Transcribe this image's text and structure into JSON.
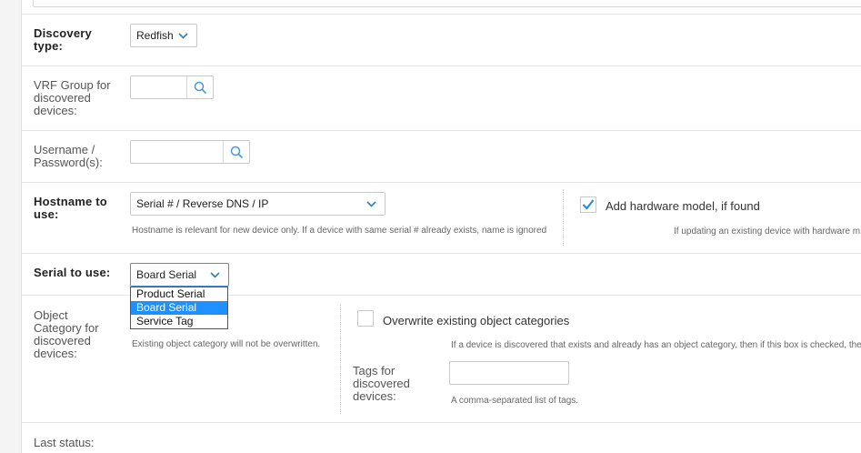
{
  "discovery": {
    "label": "Discovery type:",
    "value": "Redfish"
  },
  "vrf_group": {
    "label": "VRF Group for discovered devices:"
  },
  "credentials": {
    "label": "Username / Password(s):"
  },
  "hostname": {
    "label": "Hostname to use:",
    "value": "Serial # / Reverse DNS / IP",
    "hint": "Hostname is relevant for new device only. If a device with same serial # already exists, name is ignored"
  },
  "hardware_model": {
    "label": "Add hardware model, if found",
    "checked": true,
    "hint": "If updating an existing device with hardware m"
  },
  "serial": {
    "label": "Serial to use:",
    "value": "Board Serial",
    "options": [
      "Product Serial",
      "Board Serial",
      "Service Tag"
    ],
    "highlighted": "Board Serial"
  },
  "object_category": {
    "label": "Object Category for discovered devices:",
    "hint": "Existing object category will not be overwritten."
  },
  "overwrite_categories": {
    "label": "Overwrite existing object categories",
    "checked": false,
    "hint": "If a device is discovered that exists and already has an object category, then if this box is checked, the"
  },
  "tags": {
    "label": "Tags for discovered devices:",
    "hint": "A comma-separated list of tags."
  },
  "last_status": {
    "label": "Last status:"
  },
  "colors": {
    "checkmark": "#2b8fd6",
    "highlight": "#1e90ff",
    "search_icon": "#4a9ad8"
  },
  "icons": {
    "dropdown": "chevron-down-icon",
    "lookup": "search-icon",
    "check": "checkmark-icon"
  }
}
